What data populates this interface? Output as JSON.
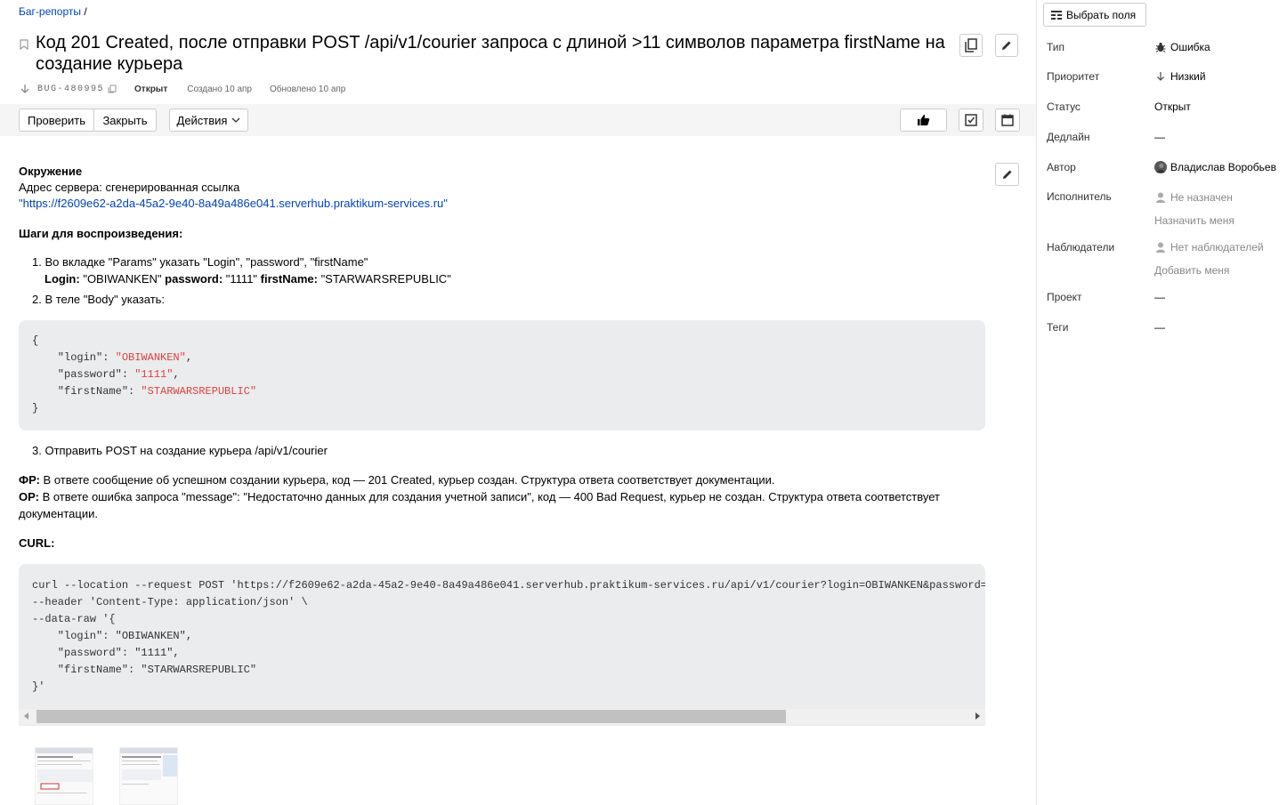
{
  "breadcrumb": {
    "link": "Баг-репорты",
    "sep": " /"
  },
  "issue": {
    "title": "Код 201 Created, после отправки POST /api/v1/courier запроса с длиной >11 символов параметра firstName на создание курьера",
    "key": "BUG-480995",
    "status": "Открыт",
    "created": "Создано 10 апр",
    "updated": "Обновлено 10 апр"
  },
  "toolbar": {
    "check": "Проверить",
    "close": "Закрыть",
    "actions": "Действия"
  },
  "description": {
    "env_title": "Окружение",
    "env_server": "Адрес сервера: сгенерированная ссылка",
    "env_url": "\"https://f2609e62-a2da-45a2-9e40-8a49a486e041.serverhub.praktikum-services.ru\"",
    "steps_title": "Шаги для воспроизведения:",
    "step1": "1. Во вкладке \"Params\" указать \"Login\", \"password\", \"firstName\"",
    "step1_login_label": "Login:",
    "step1_login_val": " \"OBIWANKEN\" ",
    "step1_pass_label": "password:",
    "step1_pass_val": " \"1111\" ",
    "step1_fn_label": "firstName:",
    "step1_fn_val": " \"STARWARSREPUBLIC\"",
    "step2": "2. В теле \"Body\" указать:",
    "code1": {
      "open": "{",
      "login_key": "    \"login\": ",
      "login_val": "\"OBIWANKEN\"",
      "password_key": "    \"password\": ",
      "password_val": "\"1111\"",
      "firstname_key": "    \"firstName\": ",
      "firstname_val": "\"STARWARSREPUBLIC\"",
      "close": "}"
    },
    "step3": "3. Отправить POST на создание курьера /api/v1/courier",
    "fr_label": "ФР:",
    "fr_text": " В ответе сообщение об успешном создании курьера, код — 201 Created, курьер создан. Структура ответа соответствует документации.",
    "or_label": "ОР:",
    "or_text": " В ответе ошибка запроса \"message\": \"Недостаточно данных для создания учетной записи\", код — 400 Bad Request, курьер не создан. Структура ответа соответствует документации.",
    "curl_title": "CURL:",
    "curl_code": "curl --location --request POST 'https://f2609e62-a2da-45a2-9e40-8a49a486e041.serverhub.praktikum-services.ru/api/v1/courier?login=OBIWANKEN&password=\n--header 'Content-Type: application/json' \\\n--data-raw '{\n    \"login\": \"OBIWANKEN\",\n    \"password\": \"1111\",\n    \"firstName\": \"STARWARSREPUBLIC\"\n}'"
  },
  "sidebar": {
    "select_fields": "Выбрать поля",
    "fields": [
      {
        "label": "Тип",
        "value": "Ошибка",
        "icon": "bug-icon"
      },
      {
        "label": "Приоритет",
        "value": "Низкий",
        "icon": "arrow-down-icon"
      },
      {
        "label": "Статус",
        "value": "Открыт"
      },
      {
        "label": "Дедлайн",
        "value": "—"
      },
      {
        "label": "Автор",
        "value": "Владислав Воробьев",
        "icon": "avatar"
      },
      {
        "label": "Исполнитель",
        "value": "Не назначен",
        "icon": "user-icon",
        "action": "Назначить меня"
      },
      {
        "label": "Наблюдатели",
        "value": "Нет наблюдателей",
        "icon": "user-icon",
        "action": "Добавить меня"
      },
      {
        "label": "Проект",
        "value": "—"
      },
      {
        "label": "Теги",
        "value": "—"
      }
    ]
  },
  "colors": {
    "link": "#0044bb",
    "code_bg": "#ebecee",
    "string": "#e04040",
    "toolbar_bg": "#f5f5f5"
  }
}
